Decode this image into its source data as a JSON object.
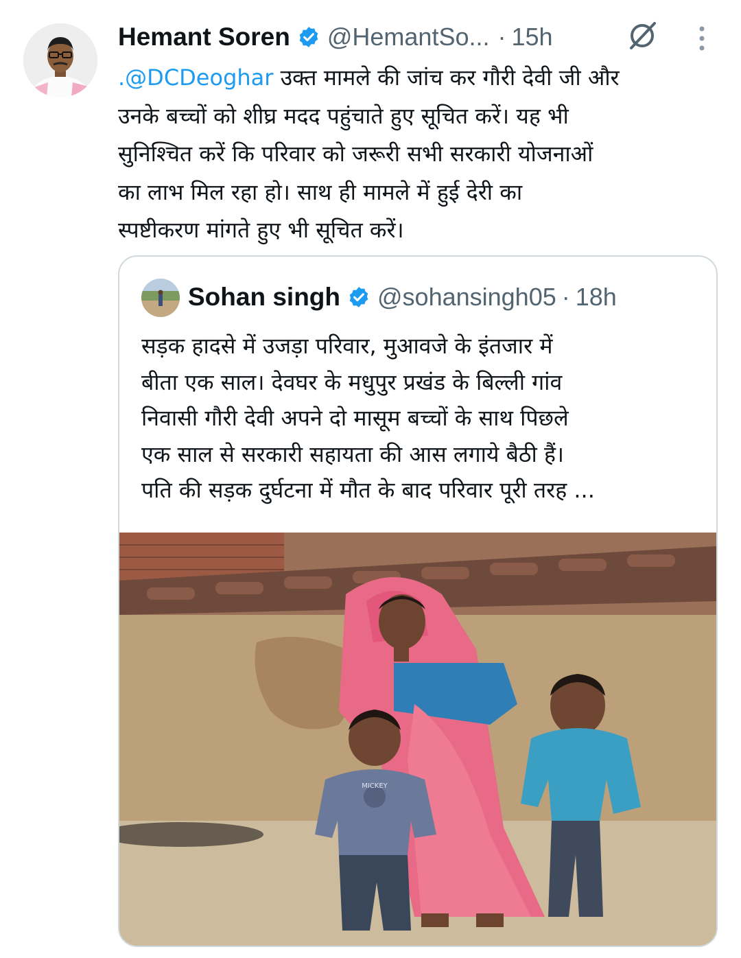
{
  "tweet": {
    "author_name": "Hemant Soren",
    "author_handle": "@HemantSo...",
    "separator": "·",
    "time": "15h",
    "mention": ".@DCDeoghar",
    "text_line1": " उक्त मामले की जांच कर गौरी देवी जी और",
    "text_line2": "उनके बच्चों को शीघ्र मदद पहुंचाते हुए सूचित करें। यह भी",
    "text_line3": "सुनिश्चित करें कि परिवार को जरूरी सभी सरकारी योजनाओं",
    "text_line4": "का लाभ मिल रहा हो। साथ ही मामले में हुई देरी का",
    "text_line5": "स्पष्टीकरण मांगते हुए भी सूचित करें।"
  },
  "quoted_tweet": {
    "author_name": "Sohan singh",
    "author_handle": "@sohansingh05",
    "separator": "·",
    "time": "18h",
    "text_line1": "सड़क हादसे में उजड़ा परिवार, मुआवजे के इंतजार में",
    "text_line2": "बीता एक साल। देवघर के मधुपुर प्रखंड के बिल्ली गांव",
    "text_line3": "निवासी गौरी देवी अपने दो मासूम बच्चों के साथ पिछले",
    "text_line4": "एक साल से सरकारी सहायता की आस लगाये बैठी हैं।",
    "text_line5": "पति की सड़क दुर्घटना में मौत के बाद परिवार पूरी तरह ...",
    "photo_shirt_text": "MICKEY"
  },
  "colors": {
    "link": "#1d9bf0",
    "verified": "#1d9bf0",
    "secondary_text": "#536471",
    "border": "#cfd9de"
  },
  "icons": [
    "verified-badge-icon",
    "grok-icon",
    "more-options-icon"
  ]
}
